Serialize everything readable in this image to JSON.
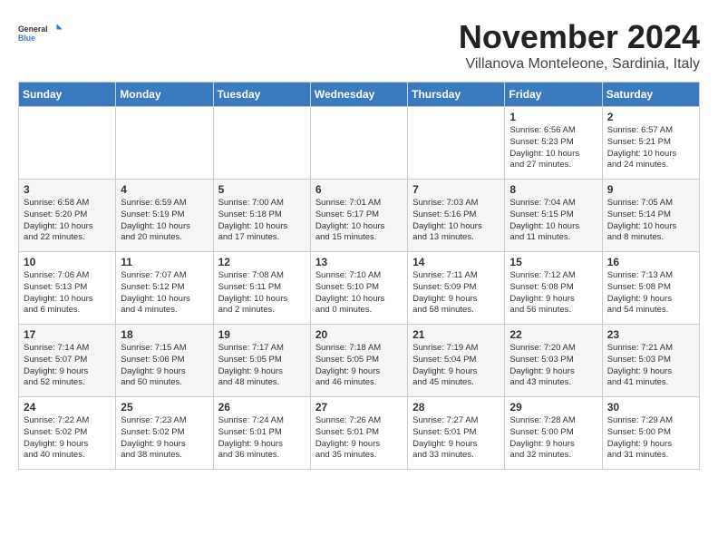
{
  "logo": {
    "line1": "General",
    "line2": "Blue"
  },
  "header": {
    "month_year": "November 2024",
    "location": "Villanova Monteleone, Sardinia, Italy"
  },
  "weekdays": [
    "Sunday",
    "Monday",
    "Tuesday",
    "Wednesday",
    "Thursday",
    "Friday",
    "Saturday"
  ],
  "weeks": [
    [
      {
        "day": "",
        "info": ""
      },
      {
        "day": "",
        "info": ""
      },
      {
        "day": "",
        "info": ""
      },
      {
        "day": "",
        "info": ""
      },
      {
        "day": "",
        "info": ""
      },
      {
        "day": "1",
        "info": "Sunrise: 6:56 AM\nSunset: 5:23 PM\nDaylight: 10 hours\nand 27 minutes."
      },
      {
        "day": "2",
        "info": "Sunrise: 6:57 AM\nSunset: 5:21 PM\nDaylight: 10 hours\nand 24 minutes."
      }
    ],
    [
      {
        "day": "3",
        "info": "Sunrise: 6:58 AM\nSunset: 5:20 PM\nDaylight: 10 hours\nand 22 minutes."
      },
      {
        "day": "4",
        "info": "Sunrise: 6:59 AM\nSunset: 5:19 PM\nDaylight: 10 hours\nand 20 minutes."
      },
      {
        "day": "5",
        "info": "Sunrise: 7:00 AM\nSunset: 5:18 PM\nDaylight: 10 hours\nand 17 minutes."
      },
      {
        "day": "6",
        "info": "Sunrise: 7:01 AM\nSunset: 5:17 PM\nDaylight: 10 hours\nand 15 minutes."
      },
      {
        "day": "7",
        "info": "Sunrise: 7:03 AM\nSunset: 5:16 PM\nDaylight: 10 hours\nand 13 minutes."
      },
      {
        "day": "8",
        "info": "Sunrise: 7:04 AM\nSunset: 5:15 PM\nDaylight: 10 hours\nand 11 minutes."
      },
      {
        "day": "9",
        "info": "Sunrise: 7:05 AM\nSunset: 5:14 PM\nDaylight: 10 hours\nand 8 minutes."
      }
    ],
    [
      {
        "day": "10",
        "info": "Sunrise: 7:06 AM\nSunset: 5:13 PM\nDaylight: 10 hours\nand 6 minutes."
      },
      {
        "day": "11",
        "info": "Sunrise: 7:07 AM\nSunset: 5:12 PM\nDaylight: 10 hours\nand 4 minutes."
      },
      {
        "day": "12",
        "info": "Sunrise: 7:08 AM\nSunset: 5:11 PM\nDaylight: 10 hours\nand 2 minutes."
      },
      {
        "day": "13",
        "info": "Sunrise: 7:10 AM\nSunset: 5:10 PM\nDaylight: 10 hours\nand 0 minutes."
      },
      {
        "day": "14",
        "info": "Sunrise: 7:11 AM\nSunset: 5:09 PM\nDaylight: 9 hours\nand 58 minutes."
      },
      {
        "day": "15",
        "info": "Sunrise: 7:12 AM\nSunset: 5:08 PM\nDaylight: 9 hours\nand 56 minutes."
      },
      {
        "day": "16",
        "info": "Sunrise: 7:13 AM\nSunset: 5:08 PM\nDaylight: 9 hours\nand 54 minutes."
      }
    ],
    [
      {
        "day": "17",
        "info": "Sunrise: 7:14 AM\nSunset: 5:07 PM\nDaylight: 9 hours\nand 52 minutes."
      },
      {
        "day": "18",
        "info": "Sunrise: 7:15 AM\nSunset: 5:06 PM\nDaylight: 9 hours\nand 50 minutes."
      },
      {
        "day": "19",
        "info": "Sunrise: 7:17 AM\nSunset: 5:05 PM\nDaylight: 9 hours\nand 48 minutes."
      },
      {
        "day": "20",
        "info": "Sunrise: 7:18 AM\nSunset: 5:05 PM\nDaylight: 9 hours\nand 46 minutes."
      },
      {
        "day": "21",
        "info": "Sunrise: 7:19 AM\nSunset: 5:04 PM\nDaylight: 9 hours\nand 45 minutes."
      },
      {
        "day": "22",
        "info": "Sunrise: 7:20 AM\nSunset: 5:03 PM\nDaylight: 9 hours\nand 43 minutes."
      },
      {
        "day": "23",
        "info": "Sunrise: 7:21 AM\nSunset: 5:03 PM\nDaylight: 9 hours\nand 41 minutes."
      }
    ],
    [
      {
        "day": "24",
        "info": "Sunrise: 7:22 AM\nSunset: 5:02 PM\nDaylight: 9 hours\nand 40 minutes."
      },
      {
        "day": "25",
        "info": "Sunrise: 7:23 AM\nSunset: 5:02 PM\nDaylight: 9 hours\nand 38 minutes."
      },
      {
        "day": "26",
        "info": "Sunrise: 7:24 AM\nSunset: 5:01 PM\nDaylight: 9 hours\nand 36 minutes."
      },
      {
        "day": "27",
        "info": "Sunrise: 7:26 AM\nSunset: 5:01 PM\nDaylight: 9 hours\nand 35 minutes."
      },
      {
        "day": "28",
        "info": "Sunrise: 7:27 AM\nSunset: 5:01 PM\nDaylight: 9 hours\nand 33 minutes."
      },
      {
        "day": "29",
        "info": "Sunrise: 7:28 AM\nSunset: 5:00 PM\nDaylight: 9 hours\nand 32 minutes."
      },
      {
        "day": "30",
        "info": "Sunrise: 7:29 AM\nSunset: 5:00 PM\nDaylight: 9 hours\nand 31 minutes."
      }
    ]
  ]
}
